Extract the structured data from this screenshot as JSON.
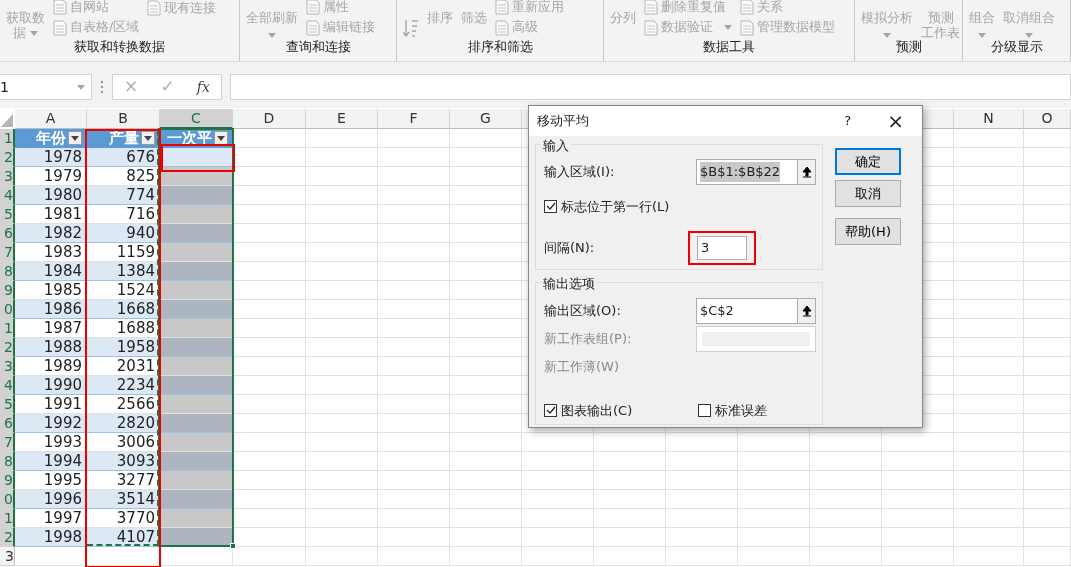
{
  "ribbon": {
    "groups": [
      {
        "label": "获取和转换数据",
        "columns": [
          [
            {
              "kind": "large",
              "lines": [
                "获取数",
                "据"
              ],
              "dropdown": true
            }
          ],
          [
            {
              "kind": "small",
              "label": "自网站"
            },
            {
              "kind": "small",
              "label": "自表格/区域"
            }
          ],
          [
            {
              "kind": "small",
              "label": "现有连接"
            }
          ]
        ]
      },
      {
        "label": "查询和连接",
        "columns": [
          [
            {
              "kind": "large",
              "lines": [
                "全部刷新"
              ],
              "dropdown": true
            }
          ],
          [
            {
              "kind": "small",
              "label": "属性"
            },
            {
              "kind": "small",
              "label": "编辑链接"
            }
          ]
        ]
      },
      {
        "label": "排序和筛选",
        "columns": [
          [
            {
              "kind": "sort"
            }
          ],
          [
            {
              "kind": "large",
              "lines": [
                "排序"
              ],
              "dropdown": false
            }
          ],
          [
            {
              "kind": "large",
              "lines": [
                "筛选"
              ],
              "dropdown": false
            }
          ],
          [
            {
              "kind": "small",
              "label": "重新应用"
            },
            {
              "kind": "small",
              "label": "高级"
            }
          ]
        ]
      },
      {
        "label": "数据工具",
        "columns": [
          [
            {
              "kind": "large",
              "lines": [
                "分列"
              ],
              "dropdown": false
            }
          ],
          [
            {
              "kind": "small",
              "label": "删除重复值"
            },
            {
              "kind": "small",
              "label": "数据验证",
              "dropdown": true
            }
          ],
          [
            {
              "kind": "small",
              "label": "关系"
            },
            {
              "kind": "small",
              "label": "管理数据模型"
            }
          ]
        ]
      },
      {
        "label": "预测",
        "columns": [
          [
            {
              "kind": "large",
              "lines": [
                "模拟分析"
              ],
              "dropdown": true
            }
          ],
          [
            {
              "kind": "large",
              "lines": [
                "预测",
                "工作表"
              ],
              "dropdown": false
            }
          ]
        ]
      },
      {
        "label": "分级显示",
        "columns": [
          [
            {
              "kind": "large",
              "lines": [
                "组合"
              ],
              "dropdown": true
            }
          ],
          [
            {
              "kind": "large",
              "lines": [
                "取消组合"
              ],
              "dropdown": true
            }
          ]
        ]
      }
    ]
  },
  "formula_bar": {
    "name_box": "1",
    "cancel": "×",
    "enter": "✓",
    "fx": "fx"
  },
  "sheet": {
    "columns": [
      {
        "letter": "A",
        "selected": false
      },
      {
        "letter": "B",
        "selected": false
      },
      {
        "letter": "C",
        "selected": true
      },
      {
        "letter": "D",
        "selected": false
      },
      {
        "letter": "E",
        "selected": false
      },
      {
        "letter": "F",
        "selected": false
      },
      {
        "letter": "G",
        "selected": false
      },
      {
        "letter": "N",
        "selected": false
      },
      {
        "letter": "O",
        "selected": false
      }
    ],
    "rows": [
      {
        "kind": "header",
        "number": "1",
        "selected": true,
        "cells": [
          "年份",
          "产量",
          "一次平"
        ]
      },
      {
        "kind": "data",
        "number": "2",
        "selected": true,
        "year": "1978",
        "output": "676",
        "active": true
      },
      {
        "kind": "data",
        "number": "3",
        "selected": true,
        "year": "1979",
        "output": "825",
        "active": false
      },
      {
        "kind": "data",
        "number": "4",
        "selected": true,
        "year": "1980",
        "output": "774",
        "active": false
      },
      {
        "kind": "data",
        "number": "5",
        "selected": true,
        "year": "1981",
        "output": "716",
        "active": false
      },
      {
        "kind": "data",
        "number": "6",
        "selected": true,
        "year": "1982",
        "output": "940",
        "active": false
      },
      {
        "kind": "data",
        "number": "7",
        "selected": true,
        "year": "1983",
        "output": "1159",
        "active": false
      },
      {
        "kind": "data",
        "number": "8",
        "selected": true,
        "year": "1984",
        "output": "1384",
        "active": false
      },
      {
        "kind": "data",
        "number": "9",
        "selected": true,
        "year": "1985",
        "output": "1524",
        "active": false
      },
      {
        "kind": "data",
        "number": "0",
        "selected": true,
        "year": "1986",
        "output": "1668",
        "active": false
      },
      {
        "kind": "data",
        "number": "1",
        "selected": true,
        "year": "1987",
        "output": "1688",
        "active": false
      },
      {
        "kind": "data",
        "number": "2",
        "selected": true,
        "year": "1988",
        "output": "1958",
        "active": false
      },
      {
        "kind": "data",
        "number": "3",
        "selected": true,
        "year": "1989",
        "output": "2031",
        "active": false
      },
      {
        "kind": "data",
        "number": "4",
        "selected": true,
        "year": "1990",
        "output": "2234",
        "active": false
      },
      {
        "kind": "data",
        "number": "5",
        "selected": true,
        "year": "1991",
        "output": "2566",
        "active": false
      },
      {
        "kind": "data",
        "number": "6",
        "selected": true,
        "year": "1992",
        "output": "2820",
        "active": false
      },
      {
        "kind": "data",
        "number": "7",
        "selected": true,
        "year": "1993",
        "output": "3006",
        "active": false
      },
      {
        "kind": "data",
        "number": "8",
        "selected": true,
        "year": "1994",
        "output": "3093",
        "active": false
      },
      {
        "kind": "data",
        "number": "9",
        "selected": true,
        "year": "1995",
        "output": "3277",
        "active": false
      },
      {
        "kind": "data",
        "number": "0",
        "selected": true,
        "year": "1996",
        "output": "3514",
        "active": false
      },
      {
        "kind": "data",
        "number": "1",
        "selected": true,
        "year": "1997",
        "output": "3770",
        "active": false
      },
      {
        "kind": "data",
        "number": "2",
        "selected": true,
        "year": "1998",
        "output": "4107",
        "active": false
      },
      {
        "kind": "empty",
        "number": "3",
        "selected": false
      }
    ]
  },
  "dialog": {
    "title": "移动平均",
    "help": "?",
    "close": "×",
    "input": {
      "legend": "输入",
      "range_label": "输入区域(I):",
      "range_value": "$B$1:$B$22",
      "range_text_selected": true,
      "labels_checkbox": {
        "label": "标志位于第一行(L)",
        "checked": true
      },
      "interval_label": "间隔(N):",
      "interval_value": "3"
    },
    "output": {
      "legend": "输出选项",
      "rows": [
        {
          "kind": "field",
          "label": "输出区域(O):",
          "value": "$C$2",
          "disabled": false
        },
        {
          "kind": "field",
          "label": "新工作表组(P):",
          "disabled": true
        },
        {
          "kind": "text",
          "label": "新工作薄(W)",
          "disabled": true
        }
      ],
      "checkboxes": [
        {
          "label": "图表输出(C)",
          "checked": true
        },
        {
          "label": "标准误差",
          "checked": false
        }
      ]
    },
    "buttons": [
      {
        "label": "确定",
        "default": true
      },
      {
        "label": "取消",
        "default": false
      },
      {
        "label": "帮助(H)",
        "default": false
      }
    ]
  }
}
